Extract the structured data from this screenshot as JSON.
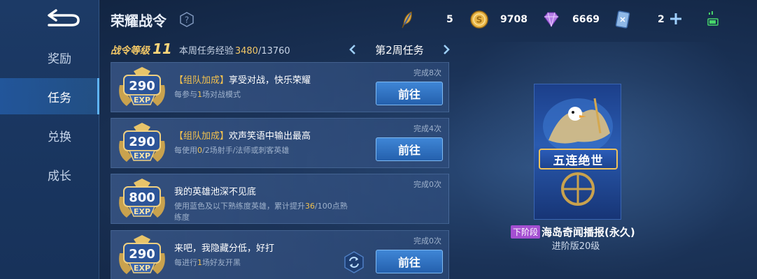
{
  "sidebar": {
    "back_icon": "back-arrow-icon",
    "items": [
      {
        "label": "奖励",
        "active": false
      },
      {
        "label": "任务",
        "active": true
      },
      {
        "label": "兑换",
        "active": false
      },
      {
        "label": "成长",
        "active": false
      }
    ]
  },
  "header": {
    "title": "荣耀战令",
    "help_icon": "question-icon",
    "currencies": [
      {
        "icon": "feather-token-icon",
        "value": "5"
      },
      {
        "icon": "gold-coin-icon",
        "value": "9708"
      },
      {
        "icon": "purple-diamond-icon",
        "value": "6669"
      },
      {
        "icon": "card-ticket-icon",
        "value": "2"
      }
    ],
    "add_icon": "plus-icon",
    "signal_icon": "signal-battery-icon"
  },
  "progress": {
    "level_label": "战令等级",
    "level": "11",
    "exp_label": "本周任务经验",
    "exp_current": "3480",
    "exp_total": "/13760"
  },
  "week": {
    "label": "第2周任务",
    "prev_icon": "chevron-left-icon",
    "next_icon": "chevron-right-icon"
  },
  "tasks": [
    {
      "exp": "290",
      "exp_unit": "EXP",
      "tag": "【组队加成】",
      "title": "享受对战，快乐荣耀",
      "desc_pre": "每参与",
      "desc_hl": "1",
      "desc_post": "场对战模式",
      "count": "完成8次",
      "button": "前往"
    },
    {
      "exp": "290",
      "exp_unit": "EXP",
      "tag": "【组队加成】",
      "title": "欢声笑语中输出最高",
      "desc_pre": "每使用",
      "desc_hl": "0",
      "desc_post": "/2场射手/法师或刺客英雄",
      "count": "完成4次",
      "button": "前往"
    },
    {
      "exp": "800",
      "exp_unit": "EXP",
      "tag": "",
      "title": "我的英雄池深不见底",
      "desc_pre": "使用蓝色及以下熟练度英雄，累计提升",
      "desc_hl": "36",
      "desc_post": "/100点熟练度",
      "count": "完成0次",
      "button": ""
    },
    {
      "exp": "290",
      "exp_unit": "EXP",
      "tag": "",
      "title": "来吧，我隐藏分低，好打",
      "desc_pre": "每进行",
      "desc_hl": "1",
      "desc_post": "场好友开黑",
      "count": "完成0次",
      "button": "前往",
      "refresh_icon": "refresh-icon"
    }
  ],
  "reward": {
    "card_text": "五连绝世",
    "stage_tag": "下阶段",
    "name": "海岛奇闻播报(永久)",
    "level": "进阶版20级"
  }
}
